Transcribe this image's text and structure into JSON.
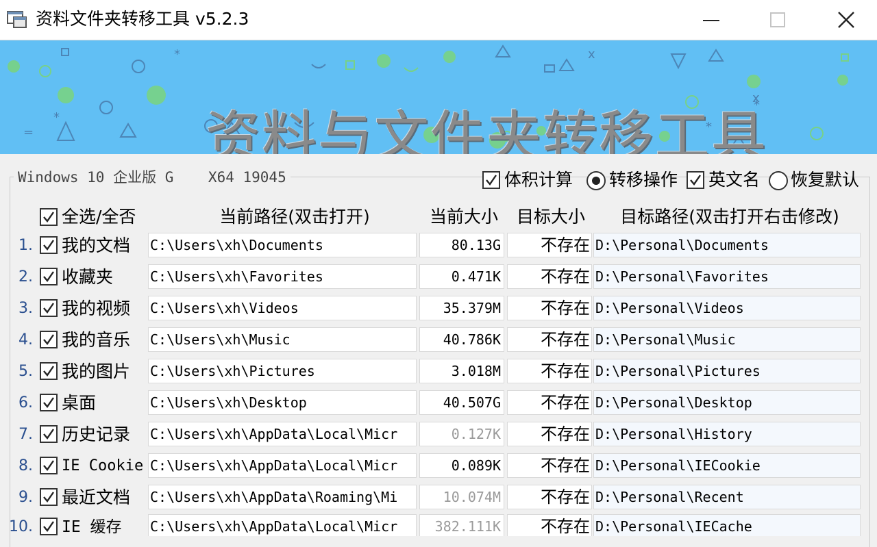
{
  "window": {
    "title": "资料文件夹转移工具 v5.2.3",
    "icon": "app-window-icon",
    "controls": [
      "minimize-icon",
      "maximize-icon",
      "close-icon"
    ]
  },
  "banner": {
    "title": "资料与文件夹转移工具",
    "background_color": "#61bff4"
  },
  "system": {
    "os_info": "Windows 10 企业版 G    X64 19045"
  },
  "options": {
    "size_calc": {
      "label": "体积计算",
      "checked": true
    },
    "transfer_op": {
      "label": "转移操作",
      "selected": true
    },
    "english_name": {
      "label": "英文名",
      "checked": true
    },
    "restore_default": {
      "label": "恢复默认",
      "selected": false
    }
  },
  "table": {
    "select_all_label": "全选/全否",
    "select_all_checked": true,
    "headers": {
      "current_path": "当前路径(双击打开)",
      "current_size": "当前大小",
      "target_size": "目标大小",
      "target_path": "目标路径(双击打开右击修改)"
    },
    "rows": [
      {
        "num": "1.",
        "label": "我的文档",
        "checked": true,
        "src": "C:\\Users\\xh\\Documents",
        "size": "80.13G",
        "size_dim": false,
        "target_size": "不存在",
        "dst": "D:\\Personal\\Documents"
      },
      {
        "num": "2.",
        "label": "收藏夹",
        "checked": true,
        "src": "C:\\Users\\xh\\Favorites",
        "size": "0.471K",
        "size_dim": false,
        "target_size": "不存在",
        "dst": "D:\\Personal\\Favorites"
      },
      {
        "num": "3.",
        "label": "我的视频",
        "checked": true,
        "src": "C:\\Users\\xh\\Videos",
        "size": "35.379M",
        "size_dim": false,
        "target_size": "不存在",
        "dst": "D:\\Personal\\Videos"
      },
      {
        "num": "4.",
        "label": "我的音乐",
        "checked": true,
        "src": "C:\\Users\\xh\\Music",
        "size": "40.786K",
        "size_dim": false,
        "target_size": "不存在",
        "dst": "D:\\Personal\\Music"
      },
      {
        "num": "5.",
        "label": "我的图片",
        "checked": true,
        "src": "C:\\Users\\xh\\Pictures",
        "size": "3.018M",
        "size_dim": false,
        "target_size": "不存在",
        "dst": "D:\\Personal\\Pictures"
      },
      {
        "num": "6.",
        "label": "桌面",
        "checked": true,
        "src": "C:\\Users\\xh\\Desktop",
        "size": "40.507G",
        "size_dim": false,
        "target_size": "不存在",
        "dst": "D:\\Personal\\Desktop"
      },
      {
        "num": "7.",
        "label": "历史记录",
        "checked": true,
        "src": "C:\\Users\\xh\\AppData\\Local\\Micr",
        "size": "0.127K",
        "size_dim": true,
        "target_size": "不存在",
        "dst": "D:\\Personal\\History"
      },
      {
        "num": "8.",
        "label": "IE Cookie",
        "checked": true,
        "src": "C:\\Users\\xh\\AppData\\Local\\Micr",
        "size": "0.089K",
        "size_dim": false,
        "target_size": "不存在",
        "dst": "D:\\Personal\\IECookie"
      },
      {
        "num": "9.",
        "label": "最近文档",
        "checked": true,
        "src": "C:\\Users\\xh\\AppData\\Roaming\\Mi",
        "size": "10.074M",
        "size_dim": true,
        "target_size": "不存在",
        "dst": "D:\\Personal\\Recent"
      },
      {
        "num": "10.",
        "label": "IE 缓存",
        "checked": true,
        "src": "C:\\Users\\xh\\AppData\\Local\\Micr",
        "size": "382.111K",
        "size_dim": true,
        "target_size": "不存在",
        "dst": "D:\\Personal\\IECache"
      }
    ]
  }
}
